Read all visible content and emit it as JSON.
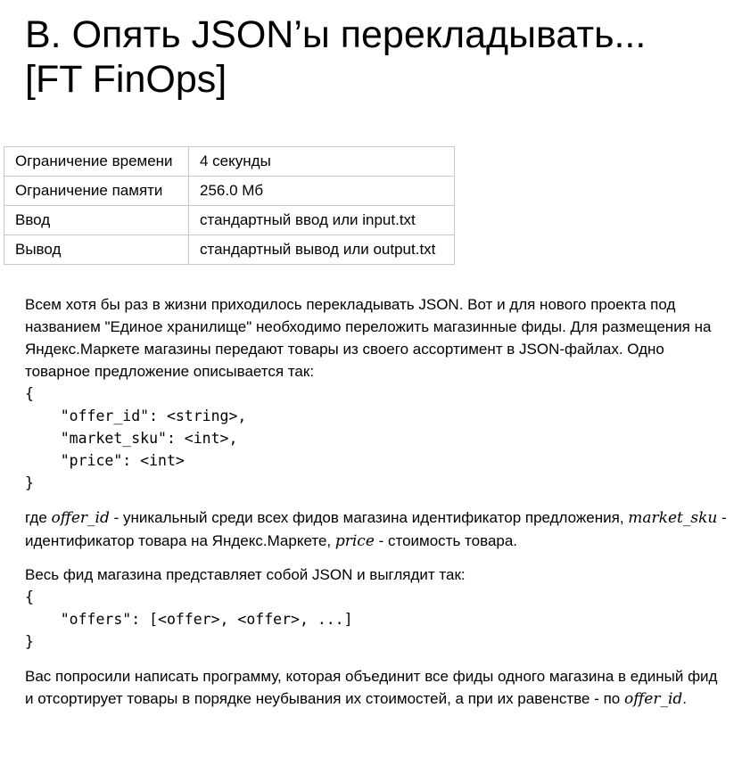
{
  "problem": {
    "title_line1": "B. Опять JSON’ы перекладывать...",
    "title_line2": "[FT FinOps]"
  },
  "limits": [
    {
      "key": "Ограничение времени",
      "value": "4 секунды"
    },
    {
      "key": "Ограничение памяти",
      "value": "256.0 Мб"
    },
    {
      "key": "Ввод",
      "value": "стандартный ввод или input.txt"
    },
    {
      "key": "Вывод",
      "value": "стандартный вывод или output.txt"
    }
  ],
  "statement": {
    "intro": "Всем хотя бы раз в жизни приходилось перекладывать JSON. Вот и для нового проекта под названием \"Единое хранилище\" необходимо переложить магазинные фиды. Для размещения на Яндекс.Маркете магазины передают товары из своего ассортимент в JSON-файлах. Одно товарное предложение описывается так:",
    "code_offer": "{\n    \"offer_id\": <string>,\n    \"market_sku\": <int>,\n    \"price\": <int>\n}",
    "where_prefix": "где ",
    "var_offer_id": "offer_id",
    "where_offer_id_desc": " - уникальный среди всех фидов магазина идентификатор предложения, ",
    "var_market_sku": "market_sku",
    "where_market_sku_desc": " - идентификатор товара на Яндекс.Маркете, ",
    "var_price": "price",
    "where_price_desc": " - стоимость товара.",
    "feed_intro": "Весь фид магазина представляет собой JSON и выглядит так:",
    "code_feed": "{\n    \"offers\": [<offer>, <offer>, ...]\n}",
    "task": "Вас попросили написать программу, которая объединит все фиды одного магазина в единый фид и отсортирует товары в порядке неубывания их стоимостей, а при их равенстве - по ",
    "task_var": "offer_id",
    "task_end": "."
  }
}
